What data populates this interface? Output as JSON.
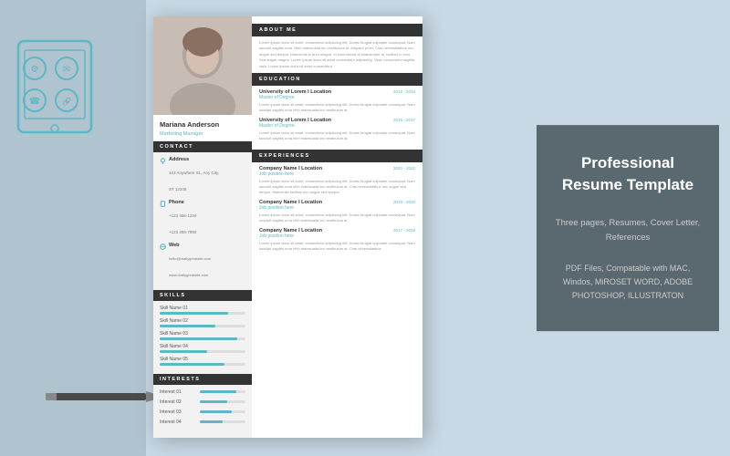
{
  "background": {
    "color": "#c8d8e4"
  },
  "resume": {
    "person": {
      "name": "Mariana Anderson",
      "title": "Marketing Manager"
    },
    "sidebar": {
      "sections": {
        "contact": {
          "header": "CONTACT",
          "items": [
            {
              "label": "Address",
              "value": "123 Anywhere St., Any City,\nST 12345"
            },
            {
              "label": "Phone",
              "value": "+123 456-1234\n+123 456-7890"
            },
            {
              "label": "Web",
              "value": "hello@reallygreatsite.com\nwww.reallygreatsite.com"
            }
          ]
        },
        "skills": {
          "header": "SKILLS",
          "items": [
            {
              "name": "Skill Name 01",
              "level": 80
            },
            {
              "name": "Skill Name 02",
              "level": 65
            },
            {
              "name": "Skill Name 03",
              "level": 90
            },
            {
              "name": "Skill Name 04",
              "level": 55
            },
            {
              "name": "Skill Name 05",
              "level": 75
            }
          ]
        },
        "interests": {
          "header": "INTERESTS",
          "items": [
            {
              "name": "Interest 01",
              "level": 80
            },
            {
              "name": "Interest 02",
              "level": 60
            },
            {
              "name": "Interest 03",
              "level": 70
            },
            {
              "name": "Interest 04",
              "level": 50
            }
          ]
        }
      }
    },
    "main": {
      "sections": {
        "about": {
          "header": "ABOUT ME",
          "text": "Lorem ipsum dolor sit amet, consectetur adipiscing elit. Donec feugiat vulputate consequat. Nam suscipit sagittis urna. Nibh malesuada leo vestibulum a. Aliquam proin. Cras necessitatibus nec augue sed tempor. Maecenas in arcu magna. Maecenas in arcu magna. In commercial at ullamcorper id, facilisis in eros. Sed augue. Lorem ipsum dolor sit amet, consectetur adipiscing elit."
        },
        "education": {
          "header": "EDUCATION",
          "items": [
            {
              "institution": "University of Lorem I Location",
              "dates": "2012 - 2015",
              "degree": "Master of Degree",
              "text": "Lorem ipsum dolor sit amet, consectetur adipiscing elit. Donec feugiat vulputate consequat. Nam suscipit sagittis urna nibh malesuada leo vestibulum at."
            },
            {
              "institution": "University of Lorem I Location",
              "dates": "2015 - 2017",
              "degree": "Master of Degree",
              "text": "Lorem ipsum dolor sit amet, consectetur adipiscing elit. Donec feugiat vulputate consequat. Nam suscipit sagittis urna nibh malesuada leo vestibulum at."
            }
          ]
        },
        "experience": {
          "header": "EXPERIENCES",
          "items": [
            {
              "company": "Company Name I Location",
              "dates": "2020 - 2022",
              "position": "Job position here",
              "text": "Lorem ipsum dolor sit amet, consectetur adipiscing elit. Donec feugiat vulputate consequat. Nam suscipit sagittis urna nibh malesuada leo vestibulum at. Cras necessitatibus nec augue sed tempor. Maecenas facilisis nec augue sed tempor."
            },
            {
              "company": "Company Name I Location",
              "dates": "2019 - 2020",
              "position": "Job position here",
              "text": "Lorem ipsum dolor sit amet, consectetur adipiscing elit. Donec feugiat vulputate consequat. Nam suscipit sagittis urna nibh malesuada leo vestibulum at. Cras necessitatibus nec augue sed tempor."
            },
            {
              "company": "Company Name I Location",
              "dates": "2017 - 2019",
              "position": "Job position here",
              "text": "Lorem ipsum dolor sit amet, consectetur adipiscing elit. Donec feugiat vulputate consequat. Nam suscipit sagittis urna nibh malesuada leo vestibulum at. Cras necessitatibus nec augue sed tempor."
            }
          ]
        }
      }
    }
  },
  "right_panel": {
    "title": "Professional Resume Template",
    "description1": "Three pages, Resumes,  Cover Letter, References",
    "description2": "PDF Files, Compatable with MAC, Windos, MiROSET\nWORD, ADOBE PHOTOSHOP, ILLUSTRATON"
  }
}
